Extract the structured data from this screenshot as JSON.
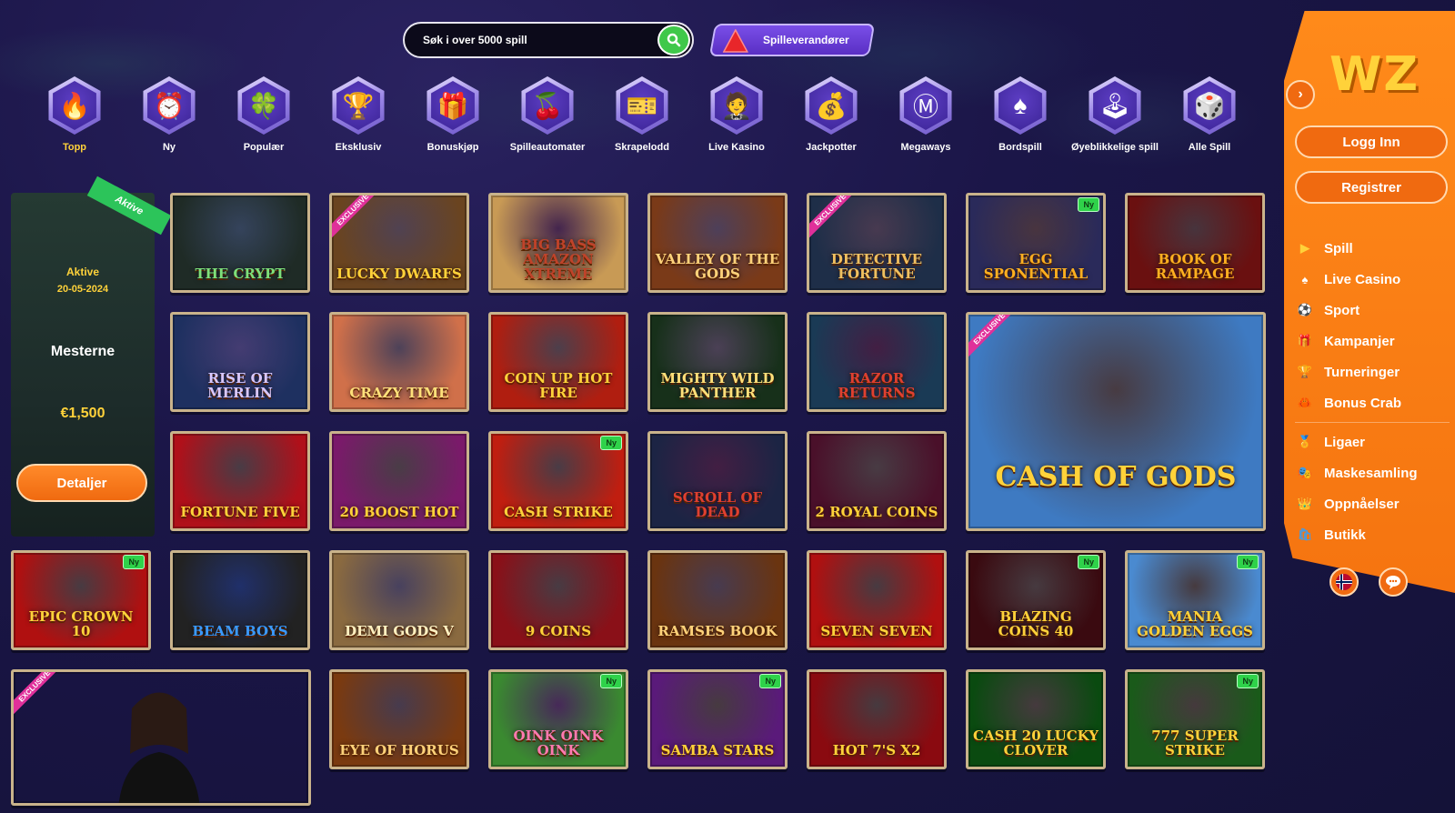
{
  "search": {
    "placeholder": "Søk i over 5000 spill"
  },
  "providers_button": {
    "label": "Spilleverandører"
  },
  "categories": [
    {
      "label": "Topp",
      "icon": "flame-icon",
      "glyph": "🔥",
      "active": true
    },
    {
      "label": "Ny",
      "icon": "alarm-clock-icon",
      "glyph": "⏰"
    },
    {
      "label": "Populær",
      "icon": "clover-icon",
      "glyph": "🍀"
    },
    {
      "label": "Eksklusiv",
      "icon": "trophy-icon",
      "glyph": "🏆"
    },
    {
      "label": "Bonuskjøp",
      "icon": "gift-icon",
      "glyph": "🎁"
    },
    {
      "label": "Spilleautomater",
      "icon": "cherries-icon",
      "glyph": "🍒"
    },
    {
      "label": "Skrapelodd",
      "icon": "scratch-card-icon",
      "glyph": "🎫"
    },
    {
      "label": "Live Kasino",
      "icon": "dealer-icon",
      "glyph": "🤵"
    },
    {
      "label": "Jackpotter",
      "icon": "money-bag-icon",
      "glyph": "💰"
    },
    {
      "label": "Megaways",
      "icon": "m-letter-icon",
      "glyph": "Ⓜ"
    },
    {
      "label": "Bordspill",
      "icon": "spade-card-icon",
      "glyph": "♠"
    },
    {
      "label": "Øyeblikkelige spill",
      "icon": "joystick-icon",
      "glyph": "🕹"
    },
    {
      "label": "Alle Spill",
      "icon": "wz-box-icon",
      "glyph": "🎲"
    }
  ],
  "tournament": {
    "flag": "Aktive",
    "status": "Aktive",
    "date": "20-05-2024",
    "name": "Mesterne",
    "prize": "€1,500",
    "button": "Detaljer"
  },
  "games": [
    {
      "name": "THE CRYPT",
      "bg": "#1f2b26",
      "fg": "#7ee07a"
    },
    {
      "name": "LUCKY DWARFS",
      "bg": "#6a4420",
      "fg": "#ffd23a",
      "exclusive": true
    },
    {
      "name": "BIG BASS AMAZON XTREME",
      "bg": "#c89a55",
      "fg": "#c0432a"
    },
    {
      "name": "VALLEY OF THE GODS",
      "bg": "#7a3a18",
      "fg": "#ffd27a"
    },
    {
      "name": "DETECTIVE FORTUNE",
      "bg": "#1e2e48",
      "fg": "#f0c060",
      "exclusive": true
    },
    {
      "name": "EGG SPONENTIAL",
      "bg": "#2a2a5a",
      "fg": "#ffb020",
      "new": true
    },
    {
      "name": "BOOK OF RAMPAGE",
      "bg": "#6a1010",
      "fg": "#ffb020"
    },
    {
      "name": "RISE OF MERLIN",
      "bg": "#1e3060",
      "fg": "#d8c8ff"
    },
    {
      "name": "CRAZY TIME",
      "bg": "#d0704a",
      "fg": "#ffe07a"
    },
    {
      "name": "COIN UP HOT FIRE",
      "bg": "#b01e10",
      "fg": "#ffd23a"
    },
    {
      "name": "MIGHTY WILD PANTHER",
      "bg": "#17301a",
      "fg": "#ffe07a"
    },
    {
      "name": "RAZOR RETURNS",
      "bg": "#1a3a55",
      "fg": "#e04030"
    },
    {
      "name": "CASH OF GODS",
      "bg": "#3e7ac2",
      "fg": "#ffd23a",
      "exclusive": true,
      "big": true
    },
    {
      "name": "FORTUNE FIVE",
      "bg": "#b0101a",
      "fg": "#ffd23a"
    },
    {
      "name": "20 BOOST HOT",
      "bg": "#7a1a6a",
      "fg": "#ffd23a"
    },
    {
      "name": "CASH STRIKE",
      "bg": "#c01e10",
      "fg": "#ffd23a",
      "new": true
    },
    {
      "name": "SCROLL OF DEAD",
      "bg": "#1c2444",
      "fg": "#e04030"
    },
    {
      "name": "2 ROYAL COINS",
      "bg": "#4a102a",
      "fg": "#ffd23a"
    },
    {
      "name": "EPIC CROWN 10",
      "bg": "#b01010",
      "fg": "#ffd23a",
      "new": true
    },
    {
      "name": "BEAM BOYS",
      "bg": "#222",
      "fg": "#3a9aff"
    },
    {
      "name": "DEMI GODS V",
      "bg": "#8a6a40",
      "fg": "#fff0c0"
    },
    {
      "name": "9 COINS",
      "bg": "#8a1018",
      "fg": "#ffd23a"
    },
    {
      "name": "RAMSES BOOK",
      "bg": "#6a3410",
      "fg": "#ffd27a"
    },
    {
      "name": "SEVEN SEVEN",
      "bg": "#b01010",
      "fg": "#ffd23a"
    },
    {
      "name": "BLAZING COINS 40",
      "bg": "#3a0a10",
      "fg": "#ffd23a",
      "new": true
    },
    {
      "name": "MANIA GOLDEN EGGS",
      "bg": "#4a8ad0",
      "fg": "#ffd23a",
      "new": true
    },
    {
      "name": "",
      "bg": "#2a2020",
      "fg": "#fff",
      "exclusive": true,
      "live": true
    },
    {
      "name": "EYE OF HORUS",
      "bg": "#7a3a10",
      "fg": "#ffd27a"
    },
    {
      "name": "OINK OINK OINK",
      "bg": "#3a8a30",
      "fg": "#ff7ab0",
      "new": true
    },
    {
      "name": "SAMBA STARS",
      "bg": "#5a1a7a",
      "fg": "#ffd23a",
      "new": true
    },
    {
      "name": "HOT 7'S X2",
      "bg": "#8a0a10",
      "fg": "#ffd23a"
    },
    {
      "name": "CASH 20 LUCKY CLOVER",
      "bg": "#0a4a10",
      "fg": "#ffd23a"
    },
    {
      "name": "777 SUPER STRIKE",
      "bg": "#1a5a1a",
      "fg": "#ffd23a",
      "new": true
    }
  ],
  "badges": {
    "new": "Ny",
    "exclusive": "EXCLUSIVE"
  },
  "sidebar": {
    "logo": "WZ",
    "login": "Logg Inn",
    "register": "Registrer",
    "menu": [
      {
        "label": "Spill",
        "icon": "play-icon",
        "glyph": "▶",
        "color": "#ffd23a"
      },
      {
        "label": "Live Casino",
        "icon": "cards-icon",
        "glyph": "♠",
        "color": "#fff"
      },
      {
        "label": "Sport",
        "icon": "football-icon",
        "glyph": "⚽",
        "color": "#4a7ae0"
      },
      {
        "label": "Kampanjer",
        "icon": "gift-icon",
        "glyph": "🎁",
        "color": "#2cc45a"
      },
      {
        "label": "Turneringer",
        "icon": "trophy-icon",
        "glyph": "🏆",
        "color": "#ffd23a"
      },
      {
        "label": "Bonus Crab",
        "icon": "crab-claw-icon",
        "glyph": "🦀",
        "color": "#ffd23a"
      },
      {
        "label": "Ligaer",
        "icon": "league-icon",
        "glyph": "🏅",
        "color": "#e04030",
        "sep_before": true
      },
      {
        "label": "Maskesamling",
        "icon": "mask-icon",
        "glyph": "🎭",
        "color": "#ffd23a"
      },
      {
        "label": "Oppnåelser",
        "icon": "crown-icon",
        "glyph": "👑",
        "color": "#ffd23a"
      },
      {
        "label": "Butikk",
        "icon": "shop-icon",
        "glyph": "🛍",
        "color": "#4a9ae0"
      }
    ]
  }
}
